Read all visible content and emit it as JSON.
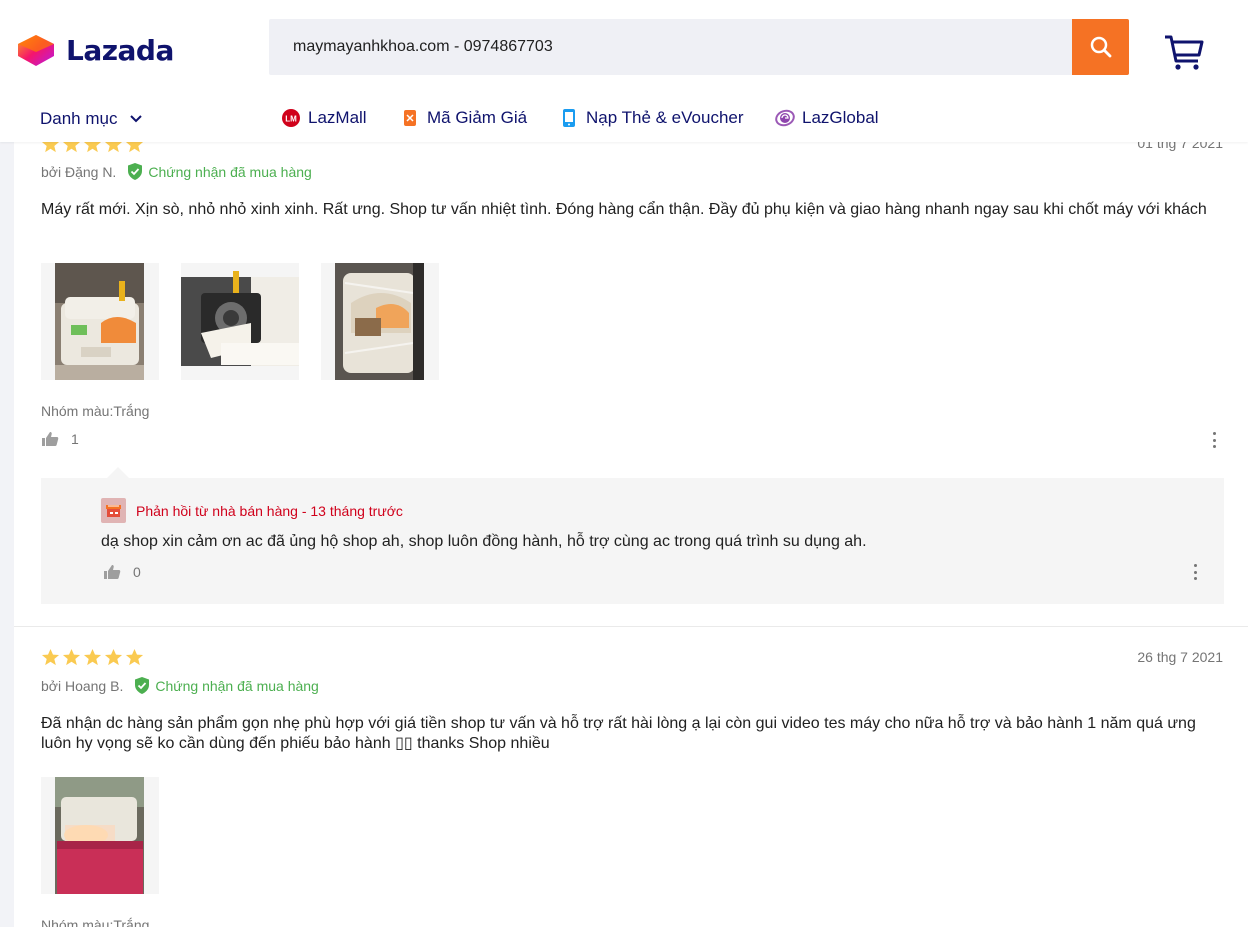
{
  "header": {
    "logo_text": "Lazada",
    "search_value": "maymayanhkhoa.com - 0974867703",
    "accent_color": "#f57224",
    "brand_color": "#0f136d"
  },
  "nav": {
    "category_label": "Danh mục",
    "items": [
      {
        "label": "LazMall",
        "icon": "lazmall-icon"
      },
      {
        "label": "Mã Giảm Giá",
        "icon": "voucher-icon"
      },
      {
        "label": "Nạp Thẻ & eVoucher",
        "icon": "topup-icon"
      },
      {
        "label": "LazGlobal",
        "icon": "lazglobal-icon"
      }
    ]
  },
  "reviews": [
    {
      "rating": 5,
      "date": "01 thg 7 2021",
      "author": "bởi Đặng N.",
      "verified": "Chứng nhận đã mua hàng",
      "content": "Máy rất mới. Xịn sò, nhỏ nhỏ xinh xinh. Rất ưng. Shop tư vấn nhiệt tình. Đóng hàng cẩn thận. Đầy đủ phụ kiện và giao hàng nhanh ngay sau khi chốt máy với khách",
      "sku": "Nhóm màu:Trắng",
      "likes": "1",
      "reply": {
        "header": "Phản hồi từ nhà bán hàng - 13 tháng trước",
        "text": "dạ shop xin cảm ơn ac đã ủng hộ shop ah, shop luôn đồng hành, hỗ trợ cùng ac trong quá trình su dụng ah.",
        "likes": "0"
      }
    },
    {
      "rating": 5,
      "date": "26 thg 7 2021",
      "author": "bởi Hoang B.",
      "verified": "Chứng nhận đã mua hàng",
      "content": "Đã nhận dc hàng sản phẩm gọn nhẹ phù hợp với giá tiền  shop tư vấn  và hỗ trợ rất hài lòng ạ  lại còn  gui video tes máy cho nữa hỗ trợ và bảo hành 1 năm quá ưng luôn hy vọng sẽ ko cần dùng đến phiếu bảo hành ▯▯ thanks Shop nhiều",
      "sku": "Nhóm màu:Trắng"
    }
  ]
}
